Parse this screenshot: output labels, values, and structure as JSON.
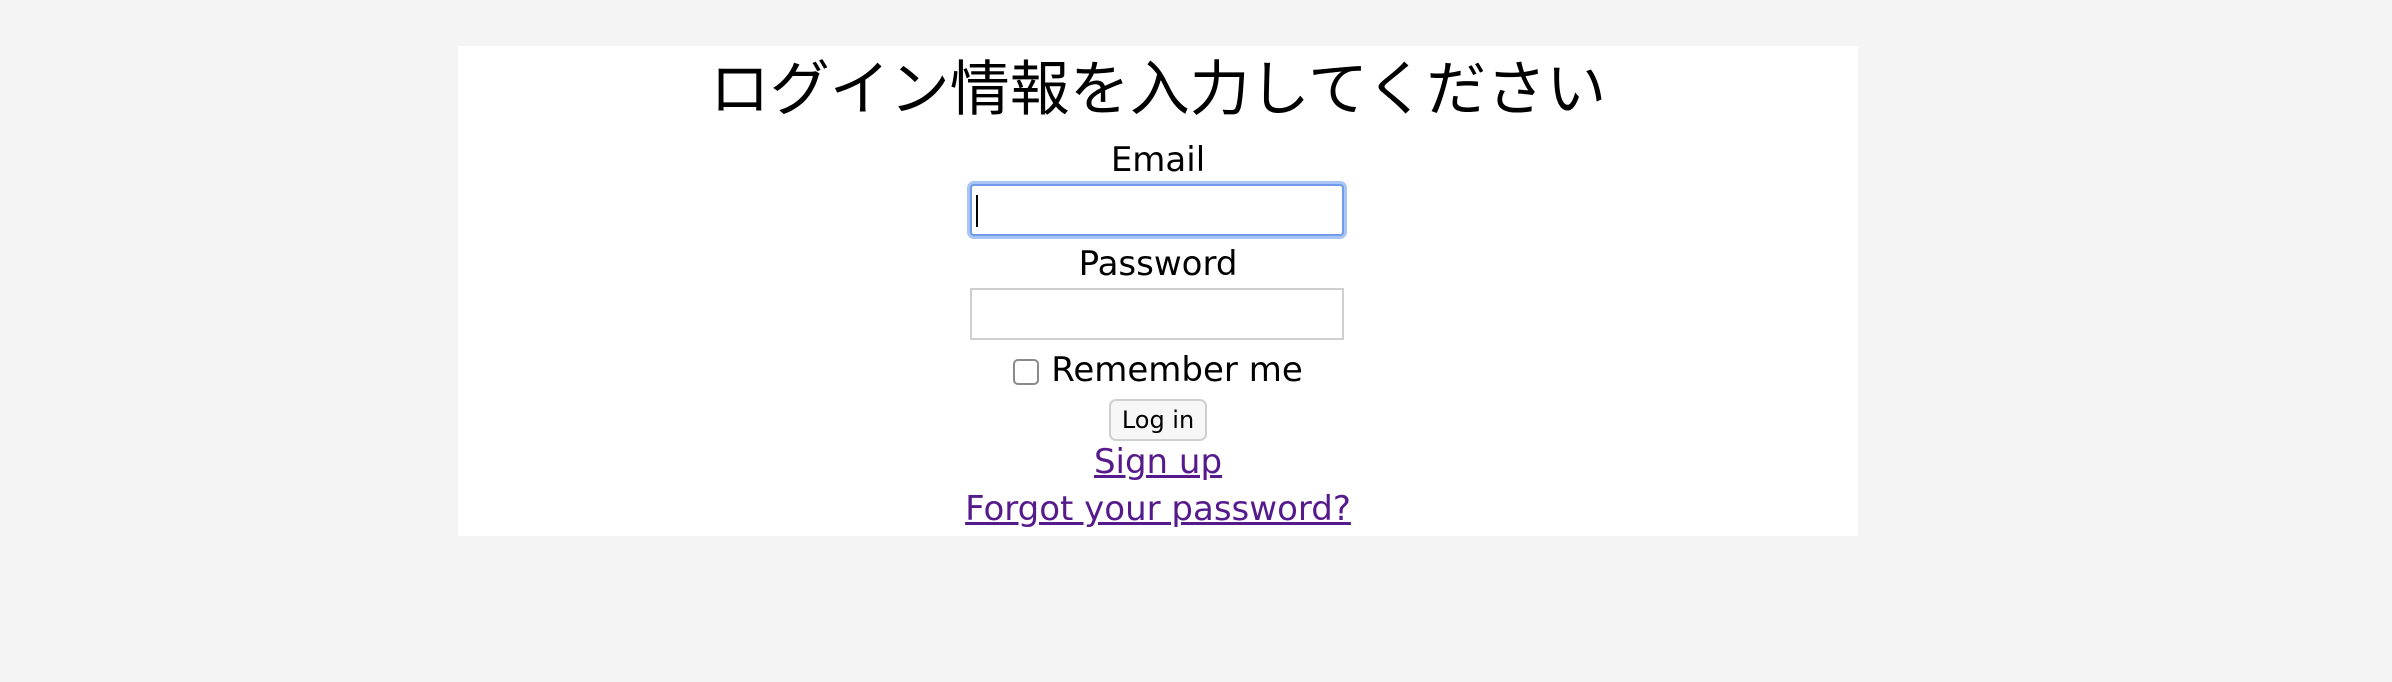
{
  "form": {
    "title": "ログイン情報を入力してください",
    "email_label": "Email",
    "email_value": "",
    "password_label": "Password",
    "password_value": "",
    "remember_label": "Remember me",
    "remember_checked": false,
    "login_label": "Log in",
    "signup_label": "Sign up",
    "forgot_label": "Forgot your password?"
  },
  "colors": {
    "focus_ring": "#6f9bea",
    "visited_link": "#551a8b",
    "page_background": "#f4f4f4",
    "card_background": "#ffffff"
  }
}
